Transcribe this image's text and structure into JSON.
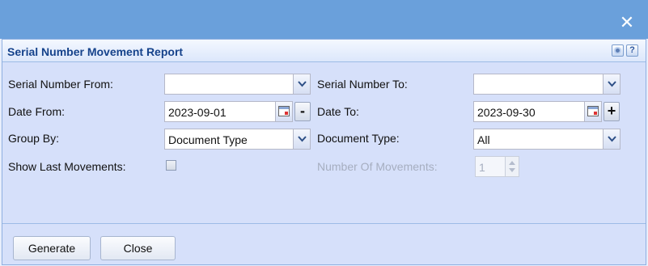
{
  "window": {
    "title": "Serial Number Movement Report",
    "close_icon": "close-icon",
    "header_icons": [
      "gear-icon",
      "help-icon"
    ],
    "help_glyph": "?"
  },
  "form": {
    "serial_from": {
      "label": "Serial Number From:",
      "value": ""
    },
    "serial_to": {
      "label": "Serial Number To:",
      "value": ""
    },
    "date_from": {
      "label": "Date From:",
      "value": "2023-09-01",
      "step_label": "-"
    },
    "date_to": {
      "label": "Date To:",
      "value": "2023-09-30",
      "step_label": "+"
    },
    "group_by": {
      "label": "Group By:",
      "value": "Document Type"
    },
    "document_type": {
      "label": "Document Type:",
      "value": "All"
    },
    "show_last_movements": {
      "label": "Show Last Movements:",
      "checked": false
    },
    "number_of_movements": {
      "label": "Number Of Movements:",
      "value": "1",
      "disabled": true
    }
  },
  "buttons": {
    "generate": "Generate",
    "close": "Close"
  },
  "colors": {
    "title_text": "#15428b",
    "topbar": "#6aa0db",
    "panel_bg": "#d6e0fa"
  }
}
